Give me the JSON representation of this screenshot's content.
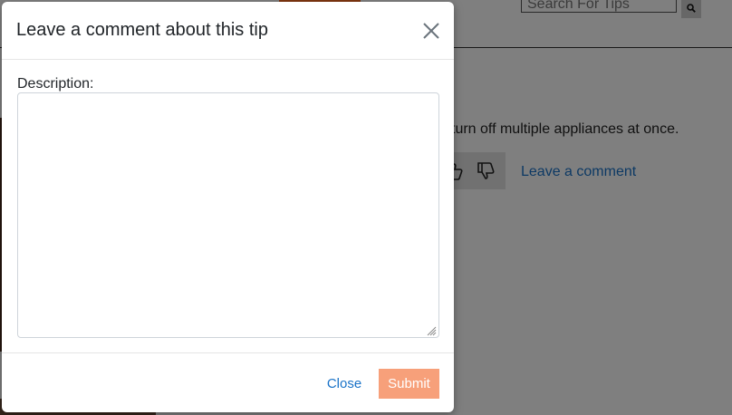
{
  "background": {
    "search_placeholder": "Search For Tips",
    "tip_text": "turn off multiple appliances at once.",
    "leave_comment_link": "Leave a comment",
    "thumbs_icons": [
      "thumbs-up-icon",
      "thumbs-down-icon"
    ],
    "search_icon": "search-icon"
  },
  "modal": {
    "title": "Leave a comment about this tip",
    "close_icon": "close-icon",
    "description_label": "Description:",
    "description_value": "",
    "buttons": {
      "close": "Close",
      "submit": "Submit"
    }
  },
  "colors": {
    "accent_orange": "#ff6a20",
    "submit_bg": "#f7a07a",
    "link_blue": "#1a73c8",
    "overlay": "rgba(0,0,0,0.5)"
  }
}
